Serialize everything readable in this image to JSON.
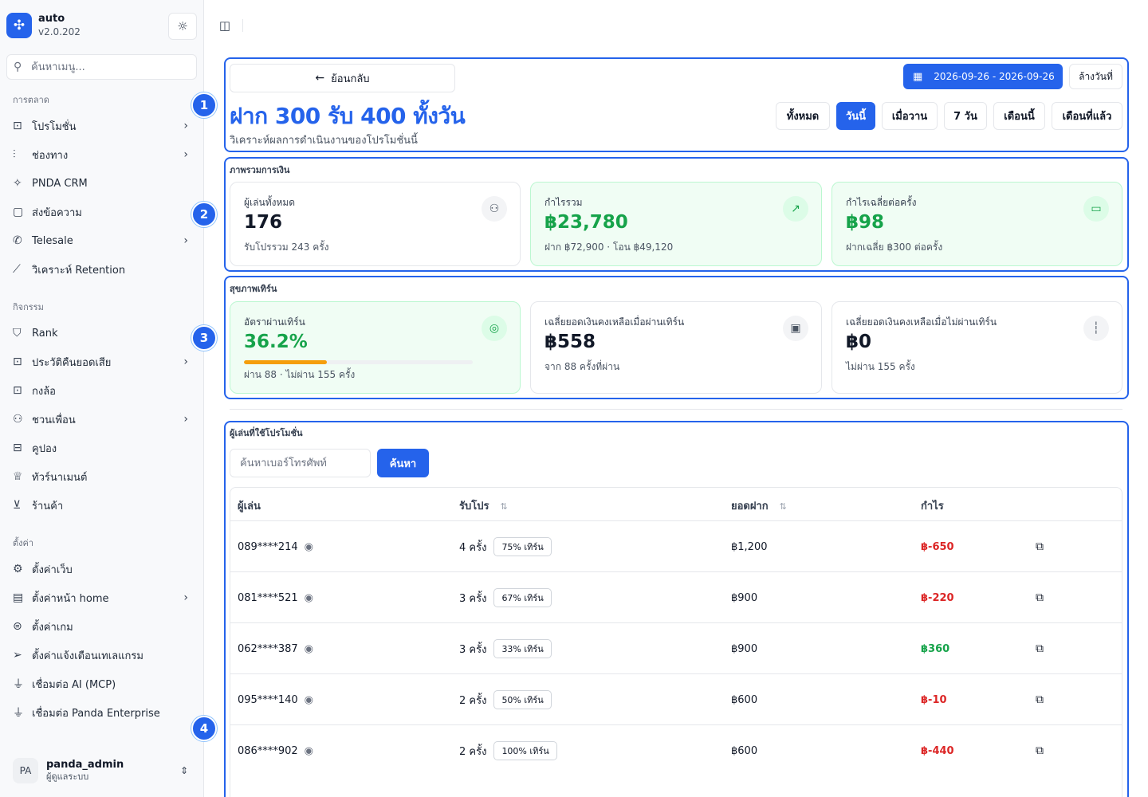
{
  "app": {
    "name": "auto",
    "version": "v2.0.202"
  },
  "sidebar": {
    "search_placeholder": "ค้นหาเมนู...",
    "sections": [
      {
        "title": "การตลาด"
      },
      {
        "title": "กิจกรรม"
      },
      {
        "title": "ตั้งค่า"
      }
    ],
    "items": [
      {
        "label": "โปรโมชั่น",
        "icon": "gift-icon",
        "has_submenu": true
      },
      {
        "label": "ช่องทาง",
        "icon": "bar-chart-icon",
        "has_submenu": true
      },
      {
        "label": "PNDA CRM",
        "icon": "sparkles-icon",
        "has_submenu": false
      },
      {
        "label": "ส่งข้อความ",
        "icon": "message-icon",
        "has_submenu": false
      },
      {
        "label": "Telesale",
        "icon": "phone-icon",
        "has_submenu": true
      },
      {
        "label": "วิเคราะห์ Retention",
        "icon": "line-chart-icon",
        "has_submenu": false
      },
      {
        "label": "Rank",
        "icon": "shield-icon",
        "has_submenu": false
      },
      {
        "label": "ประวัติคืนยอดเสีย",
        "icon": "gift-icon",
        "has_submenu": true
      },
      {
        "label": "กงล้อ",
        "icon": "gift-icon",
        "has_submenu": false
      },
      {
        "label": "ชวนเพื่อน",
        "icon": "user-plus-icon",
        "has_submenu": true
      },
      {
        "label": "คูปอง",
        "icon": "ticket-icon",
        "has_submenu": false
      },
      {
        "label": "ทัวร์นาเมนต์",
        "icon": "trophy-icon",
        "has_submenu": false
      },
      {
        "label": "ร้านค้า",
        "icon": "cart-icon",
        "has_submenu": false
      },
      {
        "label": "ตั้งค่าเว็บ",
        "icon": "gear-icon",
        "has_submenu": false
      },
      {
        "label": "ตั้งค่าหน้า home",
        "icon": "layout-icon",
        "has_submenu": true
      },
      {
        "label": "ตั้งค่าเกม",
        "icon": "gamepad-icon",
        "has_submenu": false
      },
      {
        "label": "ตั้งค่าแจ้งเตือนเทเลแกรม",
        "icon": "send-icon",
        "has_submenu": false
      },
      {
        "label": "เชื่อมต่อ AI (MCP)",
        "icon": "plug-icon",
        "has_submenu": false
      },
      {
        "label": "เชื่อมต่อ Panda Enterprise",
        "icon": "plug-icon",
        "has_submenu": false
      }
    ],
    "user": {
      "initials": "PA",
      "name": "panda_admin",
      "role": "ผู้ดูแลระบบ"
    }
  },
  "annotations": [
    "1",
    "2",
    "3",
    "4"
  ],
  "header": {
    "back_label": "ย้อนกลับ",
    "title": "ฝาก 300 รับ 400 ทั้งวัน",
    "subtitle": "วิเคราะห์ผลการดำเนินงานของโปรโมชั่นนี้",
    "date_range": "2026-09-26 - 2026-09-26",
    "clear_label": "ล้างวันที่",
    "ranges": [
      "ทั้งหมด",
      "วันนี้",
      "เมื่อวาน",
      "7 วัน",
      "เดือนนี้",
      "เดือนที่แล้ว"
    ],
    "active_range": "วันนี้"
  },
  "finance": {
    "title": "ภาพรวมการเงิน",
    "cards": [
      {
        "label": "ผู้เล่นทั้งหมด",
        "value": "176",
        "sub": "รับโปรรวม 243 ครั้ง",
        "icon": "users-icon"
      },
      {
        "label": "กำไรรวม",
        "value": "฿23,780",
        "sub": "ฝาก ฿72,900 · โอน ฿49,120",
        "icon": "trending-up-icon"
      },
      {
        "label": "กำไรเฉลี่ยต่อครั้ง",
        "value": "฿98",
        "sub": "ฝากเฉลี่ย ฿300 ต่อครั้ง",
        "icon": "banknote-icon"
      }
    ]
  },
  "turnover": {
    "title": "สุขภาพเทิร์น",
    "cards": [
      {
        "label": "อัตราผ่านเทิร์น",
        "value": "36.2%",
        "progress": 0.362,
        "sub": "ผ่าน 88 · ไม่ผ่าน 155 ครั้ง",
        "icon": "target-icon"
      },
      {
        "label": "เฉลี่ยยอดเงินคงเหลือเมื่อผ่านเทิร์น",
        "value": "฿558",
        "sub": "จาก 88 ครั้งที่ผ่าน",
        "icon": "wallet-icon"
      },
      {
        "label": "เฉลี่ยยอดเงินคงเหลือเมื่อไม่ผ่านเทิร์น",
        "value": "฿0",
        "sub": "ไม่ผ่าน 155 ครั้ง",
        "icon": "bar-chart-icon"
      }
    ]
  },
  "players": {
    "title": "ผู้เล่นที่ใช้โปรโมชั่น",
    "search_placeholder": "ค้นหาเบอร์โทรศัพท์",
    "search_button": "ค้นหา",
    "columns": [
      "ผู้เล่น",
      "รับโปร",
      "ยอดฝาก",
      "กำไร"
    ],
    "rows": [
      {
        "phone": "089****214",
        "claims": "4 ครั้ง",
        "turn": "75% เทิร์น",
        "deposit": "฿1,200",
        "profit": "฿-650",
        "positive": false
      },
      {
        "phone": "081****521",
        "claims": "3 ครั้ง",
        "turn": "67% เทิร์น",
        "deposit": "฿900",
        "profit": "฿-220",
        "positive": false
      },
      {
        "phone": "062****387",
        "claims": "3 ครั้ง",
        "turn": "33% เทิร์น",
        "deposit": "฿900",
        "profit": "฿360",
        "positive": true
      },
      {
        "phone": "095****140",
        "claims": "2 ครั้ง",
        "turn": "50% เทิร์น",
        "deposit": "฿600",
        "profit": "฿-10",
        "positive": false
      },
      {
        "phone": "086****902",
        "claims": "2 ครั้ง",
        "turn": "100% เทิร์น",
        "deposit": "฿600",
        "profit": "฿-440",
        "positive": false
      }
    ]
  }
}
